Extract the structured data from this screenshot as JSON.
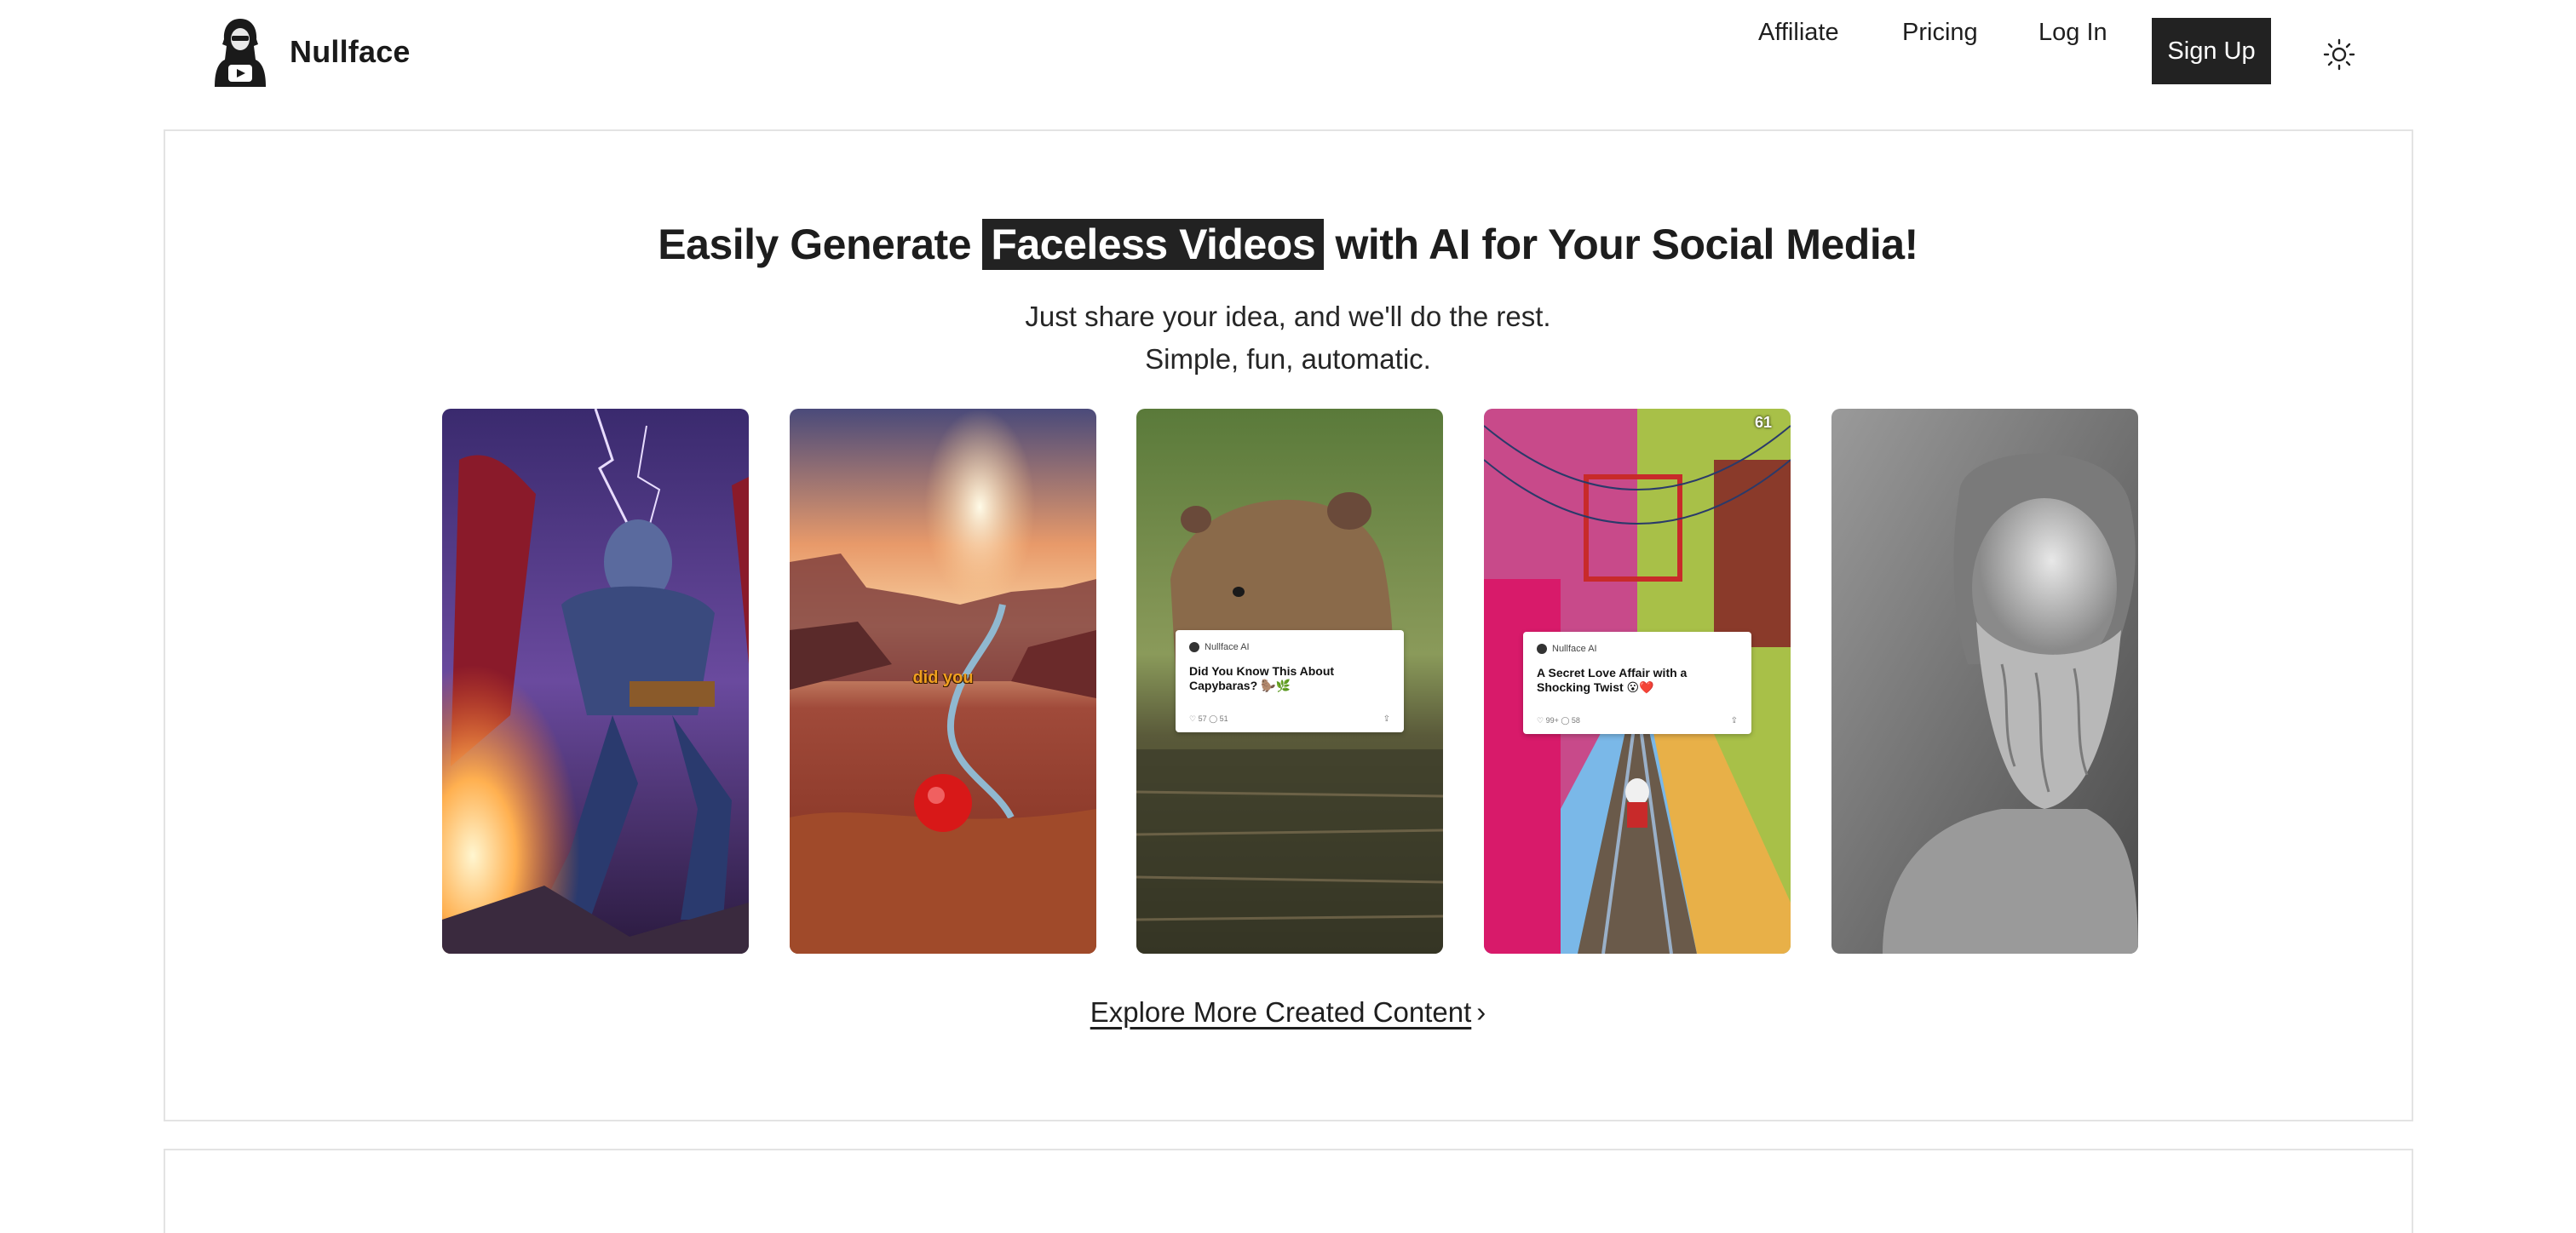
{
  "brand": {
    "name": "Nullface",
    "logo_icon": "hooded-figure-logo-icon"
  },
  "nav": {
    "affiliate": "Affiliate",
    "pricing": "Pricing",
    "login": "Log In",
    "signup": "Sign Up",
    "theme_icon": "sun-icon"
  },
  "hero": {
    "title_before": "Easily Generate ",
    "title_highlight": "Faceless Videos",
    "title_after": " with AI for Your Social Media!",
    "subtitle_line1": "Just share your idea, and we'll do the rest.",
    "subtitle_line2": "Simple, fun, automatic."
  },
  "videos": [
    {
      "subject": "armored superhero with lightning"
    },
    {
      "subject": "red desert canyon at sunset",
      "caption": "did you"
    },
    {
      "subject": "capybara in water",
      "card_brand": "Nullface AI",
      "card_title": "Did You Know This About Capybaras? 🦫🌿",
      "card_meta": "♡ 57   ◯ 51"
    },
    {
      "subject": "endless runner game",
      "counter": "61",
      "card_brand": "Nullface AI",
      "card_title": "A Secret Love Affair with a Shocking Twist 😮❤️",
      "card_meta": "♡ 99+   ◯ 58"
    },
    {
      "subject": "marble bust of philosopher"
    }
  ],
  "explore": {
    "label": "Explore More Created Content",
    "chevron_icon": "chevron-right-icon"
  },
  "colors": {
    "accent": "#222222",
    "border": "#e3e3e3",
    "background": "#ffffff"
  }
}
